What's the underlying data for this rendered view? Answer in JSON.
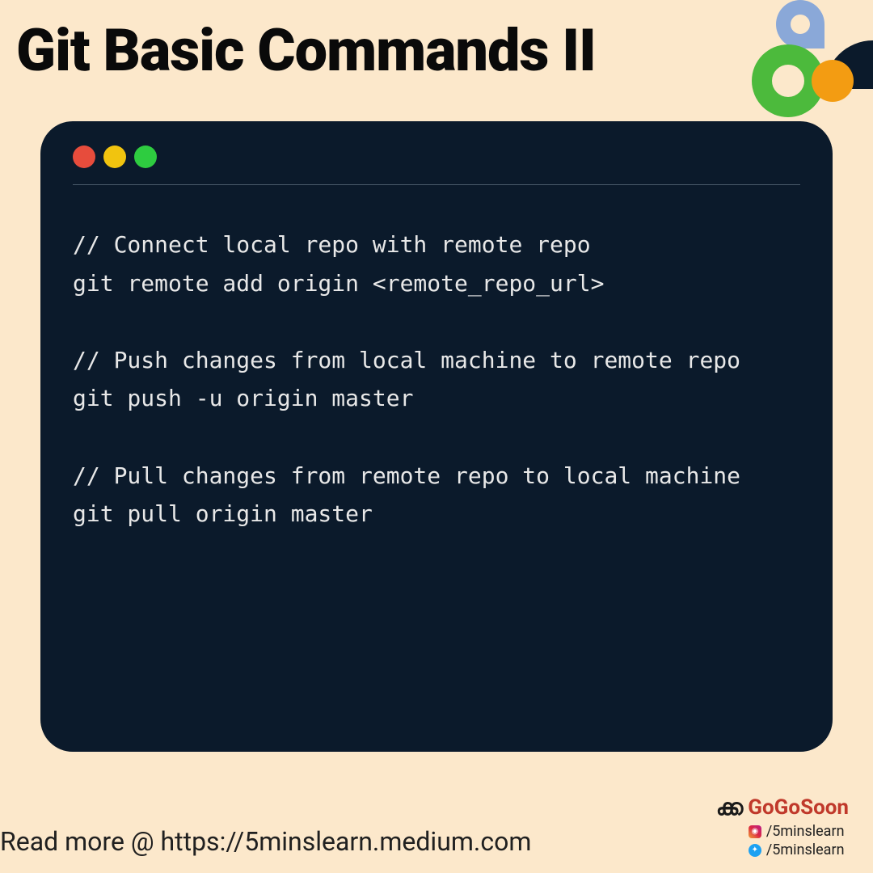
{
  "title": "Git Basic Commands II",
  "code": {
    "block1_comment": "// Connect local repo with remote repo",
    "block1_cmd": "git remote add origin <remote_repo_url>",
    "block2_comment": "// Push changes from local machine to remote repo",
    "block2_cmd": "git push -u origin master",
    "block3_comment": "// Pull changes from remote repo to local machine",
    "block3_cmd": "git pull origin master"
  },
  "footer": "Read more @ https://5minslearn.medium.com",
  "brand": {
    "name": "GoGoSoon",
    "social1": "/5minslearn",
    "social2": "/5minslearn"
  },
  "colors": {
    "bg": "#fce8cb",
    "terminal": "#0b1a2b",
    "red": "#e74c3c",
    "yellow": "#f1c40f",
    "green": "#2ecc40",
    "orange": "#f39c12",
    "blue": "#8aa8d8"
  }
}
